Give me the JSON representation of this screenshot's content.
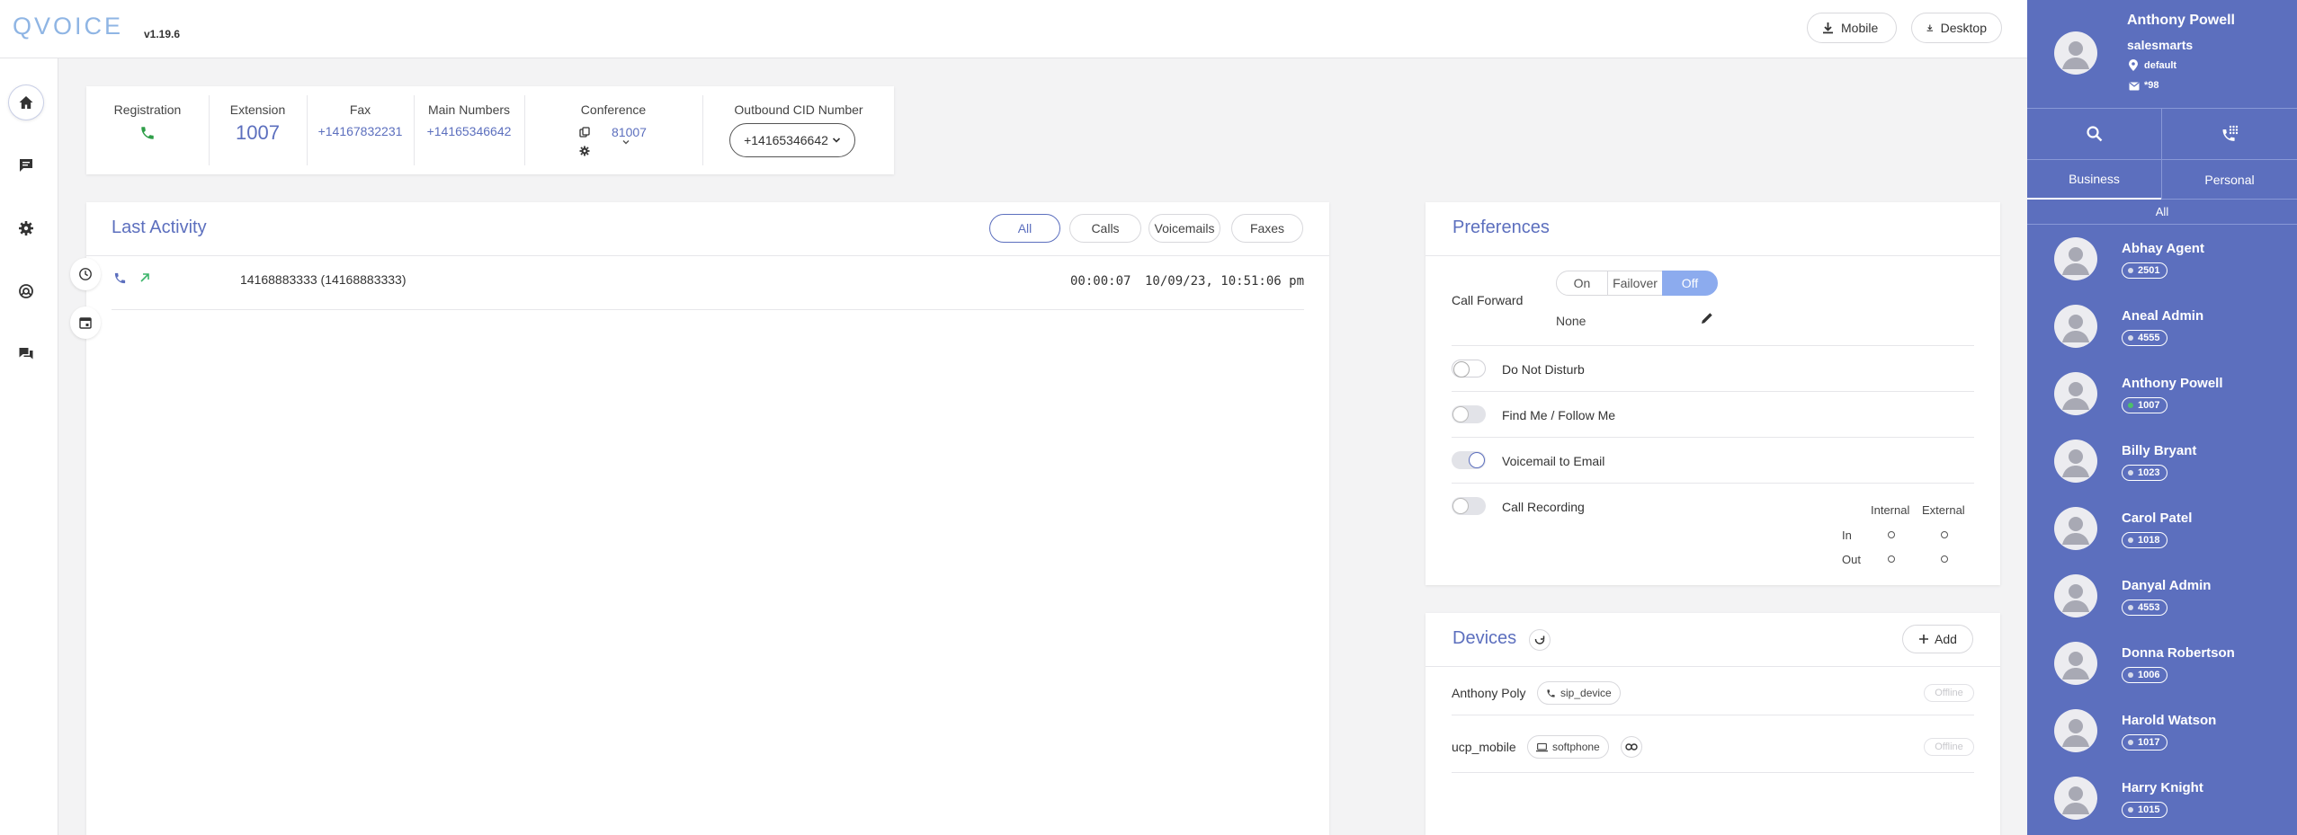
{
  "app": {
    "logo": "QVOICE",
    "version": "v1.19.6"
  },
  "downloads": {
    "mobile": "Mobile",
    "desktop": "Desktop"
  },
  "rail": [
    "home-icon",
    "chat-icon",
    "gear-icon",
    "headset-icon",
    "messages-icon"
  ],
  "stats": {
    "registration_label": "Registration",
    "extension_label": "Extension",
    "extension_value": "1007",
    "fax_label": "Fax",
    "fax_value": "+14167832231",
    "main_label": "Main Numbers",
    "main_value": "+14165346642",
    "conference_label": "Conference",
    "conference_value": "81007",
    "cid_label": "Outbound CID Number",
    "cid_value": "+14165346642"
  },
  "activity": {
    "title": "Last Activity",
    "filters": [
      "All",
      "Calls",
      "Voicemails",
      "Faxes"
    ],
    "active_filter": "All",
    "rows": [
      {
        "number": "14168883333 (14168883333)",
        "duration": "00:00:07",
        "datetime": "10/09/23, 10:51:06 pm"
      }
    ]
  },
  "preferences": {
    "title": "Preferences",
    "call_forward": {
      "label": "Call Forward",
      "options": [
        "On",
        "Failover",
        "Off"
      ],
      "selected": "Off",
      "target": "None"
    },
    "do_not_disturb": {
      "label": "Do Not Disturb",
      "enabled": false
    },
    "find_me": {
      "label": "Find Me / Follow Me",
      "enabled": false
    },
    "voicemail_email": {
      "label": "Voicemail to Email",
      "enabled": true
    },
    "call_recording": {
      "label": "Call Recording",
      "enabled": false,
      "columns": [
        "Internal",
        "External"
      ],
      "rows": [
        "In",
        "Out"
      ]
    }
  },
  "devices": {
    "title": "Devices",
    "add_label": "Add",
    "items": [
      {
        "name": "Anthony Poly",
        "type": "sip_device",
        "status": "Offline"
      },
      {
        "name": "ucp_mobile",
        "type": "softphone",
        "status": "Offline"
      }
    ]
  },
  "user": {
    "name": "Anthony Powell",
    "org": "salesmarts",
    "location": "default",
    "voicemail": "*98"
  },
  "directory": {
    "tabs": [
      "Business",
      "Personal"
    ],
    "active_tab": "Business",
    "filter": "All",
    "contacts": [
      {
        "name": "Abhay Agent",
        "ext": "2501",
        "online": false
      },
      {
        "name": "Aneal Admin",
        "ext": "4555",
        "online": false
      },
      {
        "name": "Anthony Powell",
        "ext": "1007",
        "online": true
      },
      {
        "name": "Billy Bryant",
        "ext": "1023",
        "online": false
      },
      {
        "name": "Carol Patel",
        "ext": "1018",
        "online": false
      },
      {
        "name": "Danyal Admin",
        "ext": "4553",
        "online": false
      },
      {
        "name": "Donna Robertson",
        "ext": "1006",
        "online": false
      },
      {
        "name": "Harold Watson",
        "ext": "1017",
        "online": false
      },
      {
        "name": "Harry Knight",
        "ext": "1015",
        "online": false
      }
    ]
  },
  "colors": {
    "accent": "#5c6fbe",
    "call_green": "#2e9e48",
    "panel": "#5c6fbe"
  }
}
